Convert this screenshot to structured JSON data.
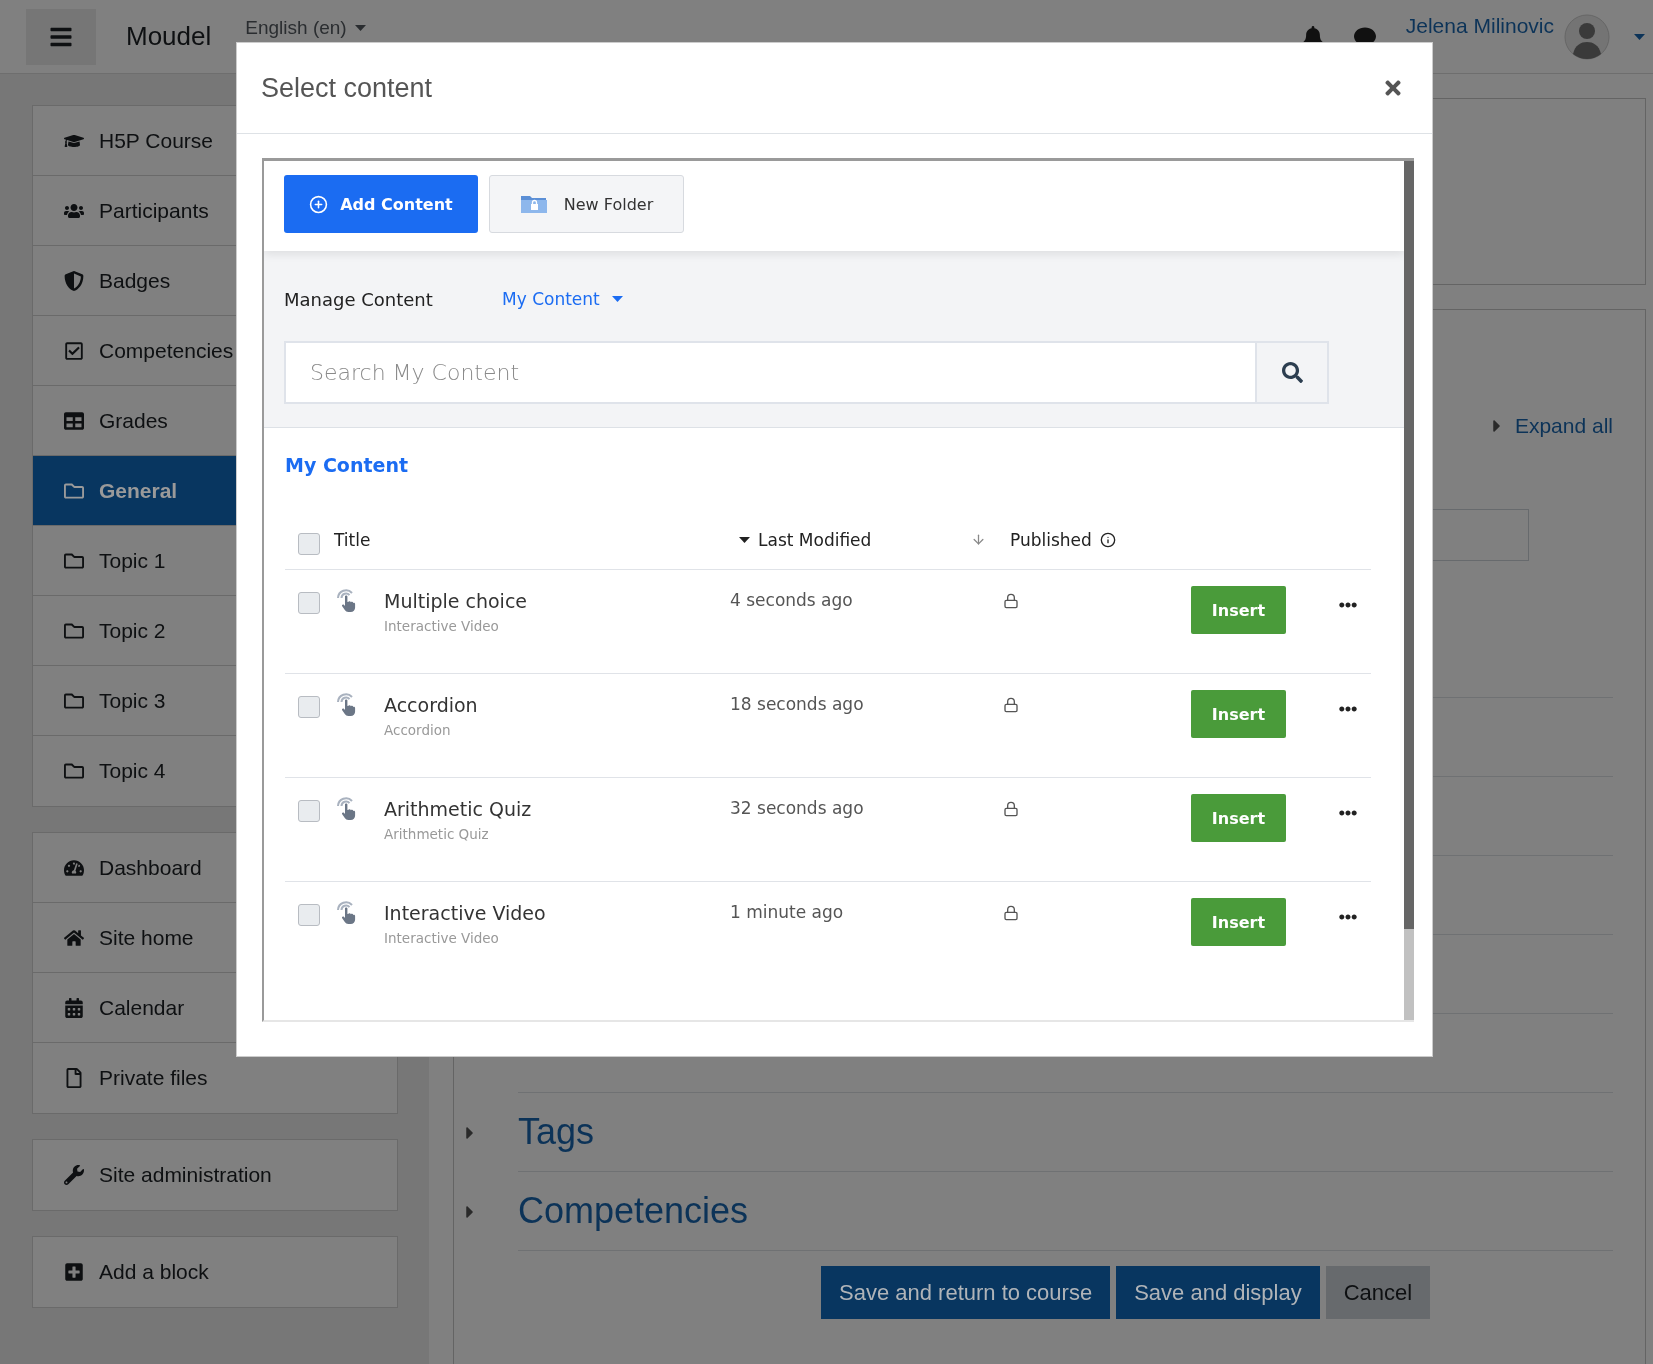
{
  "navbar": {
    "brand": "Moudel",
    "language": "English (en)",
    "user_name": "Jelena Milinovic"
  },
  "sidebar": {
    "groups": [
      {
        "items": [
          {
            "label": "H5P Course",
            "selected": false
          },
          {
            "label": "Participants",
            "selected": false
          },
          {
            "label": "Badges",
            "selected": false
          },
          {
            "label": "Competencies",
            "selected": false
          },
          {
            "label": "Grades",
            "selected": false
          },
          {
            "label": "General",
            "selected": true
          },
          {
            "label": "Topic 1",
            "selected": false
          },
          {
            "label": "Topic 2",
            "selected": false
          },
          {
            "label": "Topic 3",
            "selected": false
          },
          {
            "label": "Topic 4",
            "selected": false
          }
        ]
      },
      {
        "items": [
          {
            "label": "Dashboard",
            "selected": false
          },
          {
            "label": "Site home",
            "selected": false
          },
          {
            "label": "Calendar",
            "selected": false
          },
          {
            "label": "Private files",
            "selected": false
          }
        ]
      },
      {
        "items": [
          {
            "label": "Site administration",
            "selected": false
          }
        ]
      },
      {
        "items": [
          {
            "label": "Add a block",
            "selected": false
          }
        ]
      }
    ]
  },
  "main": {
    "expand_all": "Expand all",
    "sections": [
      {
        "title": "Tags"
      },
      {
        "title": "Competencies"
      }
    ],
    "buttons": [
      {
        "label": "Save and return to course",
        "kind": "primary"
      },
      {
        "label": "Save and display",
        "kind": "primary"
      },
      {
        "label": "Cancel",
        "kind": "secondary"
      }
    ]
  },
  "modal": {
    "title": "Select content",
    "add_content": "Add Content",
    "new_folder": "New Folder",
    "manage_label": "Manage Content",
    "source_dropdown": "My Content",
    "search": {
      "placeholder": "Search My Content"
    },
    "heading": "My Content",
    "table": {
      "select_all_checked": false,
      "columns": {
        "title": "Title",
        "last_modified": "Last Modified",
        "published": "Published"
      },
      "rows": [
        {
          "title": "Multiple choice",
          "type": "Interactive Video",
          "modified": "4 seconds ago",
          "checked": false,
          "published": false,
          "action": "Insert"
        },
        {
          "title": "Accordion",
          "type": "Accordion",
          "modified": "18 seconds ago",
          "checked": false,
          "published": false,
          "action": "Insert"
        },
        {
          "title": "Arithmetic Quiz",
          "type": "Arithmetic Quiz",
          "modified": "32 seconds ago",
          "checked": false,
          "published": false,
          "action": "Insert"
        },
        {
          "title": "Interactive Video",
          "type": "Interactive Video",
          "modified": "1 minute ago",
          "checked": false,
          "published": false,
          "action": "Insert"
        }
      ]
    }
  }
}
